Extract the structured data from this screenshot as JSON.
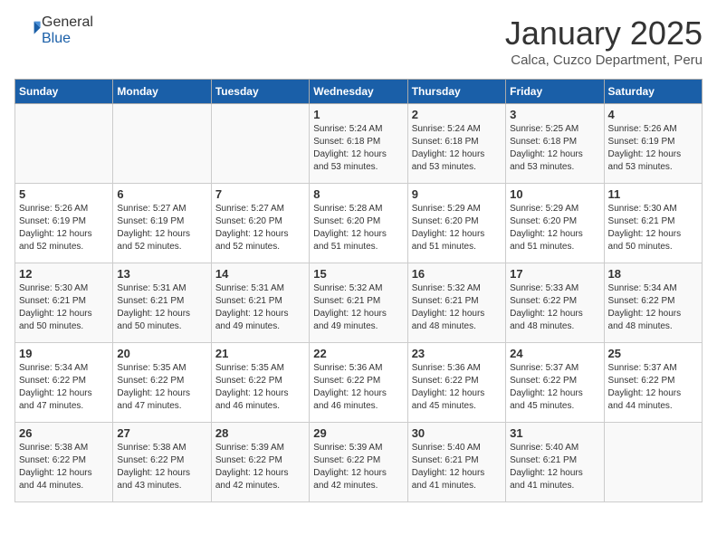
{
  "logo": {
    "general": "General",
    "blue": "Blue"
  },
  "header": {
    "month": "January 2025",
    "location": "Calca, Cuzco Department, Peru"
  },
  "days_of_week": [
    "Sunday",
    "Monday",
    "Tuesday",
    "Wednesday",
    "Thursday",
    "Friday",
    "Saturday"
  ],
  "weeks": [
    [
      {
        "day": "",
        "content": ""
      },
      {
        "day": "",
        "content": ""
      },
      {
        "day": "",
        "content": ""
      },
      {
        "day": "1",
        "content": "Sunrise: 5:24 AM\nSunset: 6:18 PM\nDaylight: 12 hours\nand 53 minutes."
      },
      {
        "day": "2",
        "content": "Sunrise: 5:24 AM\nSunset: 6:18 PM\nDaylight: 12 hours\nand 53 minutes."
      },
      {
        "day": "3",
        "content": "Sunrise: 5:25 AM\nSunset: 6:18 PM\nDaylight: 12 hours\nand 53 minutes."
      },
      {
        "day": "4",
        "content": "Sunrise: 5:26 AM\nSunset: 6:19 PM\nDaylight: 12 hours\nand 53 minutes."
      }
    ],
    [
      {
        "day": "5",
        "content": "Sunrise: 5:26 AM\nSunset: 6:19 PM\nDaylight: 12 hours\nand 52 minutes."
      },
      {
        "day": "6",
        "content": "Sunrise: 5:27 AM\nSunset: 6:19 PM\nDaylight: 12 hours\nand 52 minutes."
      },
      {
        "day": "7",
        "content": "Sunrise: 5:27 AM\nSunset: 6:20 PM\nDaylight: 12 hours\nand 52 minutes."
      },
      {
        "day": "8",
        "content": "Sunrise: 5:28 AM\nSunset: 6:20 PM\nDaylight: 12 hours\nand 51 minutes."
      },
      {
        "day": "9",
        "content": "Sunrise: 5:29 AM\nSunset: 6:20 PM\nDaylight: 12 hours\nand 51 minutes."
      },
      {
        "day": "10",
        "content": "Sunrise: 5:29 AM\nSunset: 6:20 PM\nDaylight: 12 hours\nand 51 minutes."
      },
      {
        "day": "11",
        "content": "Sunrise: 5:30 AM\nSunset: 6:21 PM\nDaylight: 12 hours\nand 50 minutes."
      }
    ],
    [
      {
        "day": "12",
        "content": "Sunrise: 5:30 AM\nSunset: 6:21 PM\nDaylight: 12 hours\nand 50 minutes."
      },
      {
        "day": "13",
        "content": "Sunrise: 5:31 AM\nSunset: 6:21 PM\nDaylight: 12 hours\nand 50 minutes."
      },
      {
        "day": "14",
        "content": "Sunrise: 5:31 AM\nSunset: 6:21 PM\nDaylight: 12 hours\nand 49 minutes."
      },
      {
        "day": "15",
        "content": "Sunrise: 5:32 AM\nSunset: 6:21 PM\nDaylight: 12 hours\nand 49 minutes."
      },
      {
        "day": "16",
        "content": "Sunrise: 5:32 AM\nSunset: 6:21 PM\nDaylight: 12 hours\nand 48 minutes."
      },
      {
        "day": "17",
        "content": "Sunrise: 5:33 AM\nSunset: 6:22 PM\nDaylight: 12 hours\nand 48 minutes."
      },
      {
        "day": "18",
        "content": "Sunrise: 5:34 AM\nSunset: 6:22 PM\nDaylight: 12 hours\nand 48 minutes."
      }
    ],
    [
      {
        "day": "19",
        "content": "Sunrise: 5:34 AM\nSunset: 6:22 PM\nDaylight: 12 hours\nand 47 minutes."
      },
      {
        "day": "20",
        "content": "Sunrise: 5:35 AM\nSunset: 6:22 PM\nDaylight: 12 hours\nand 47 minutes."
      },
      {
        "day": "21",
        "content": "Sunrise: 5:35 AM\nSunset: 6:22 PM\nDaylight: 12 hours\nand 46 minutes."
      },
      {
        "day": "22",
        "content": "Sunrise: 5:36 AM\nSunset: 6:22 PM\nDaylight: 12 hours\nand 46 minutes."
      },
      {
        "day": "23",
        "content": "Sunrise: 5:36 AM\nSunset: 6:22 PM\nDaylight: 12 hours\nand 45 minutes."
      },
      {
        "day": "24",
        "content": "Sunrise: 5:37 AM\nSunset: 6:22 PM\nDaylight: 12 hours\nand 45 minutes."
      },
      {
        "day": "25",
        "content": "Sunrise: 5:37 AM\nSunset: 6:22 PM\nDaylight: 12 hours\nand 44 minutes."
      }
    ],
    [
      {
        "day": "26",
        "content": "Sunrise: 5:38 AM\nSunset: 6:22 PM\nDaylight: 12 hours\nand 44 minutes."
      },
      {
        "day": "27",
        "content": "Sunrise: 5:38 AM\nSunset: 6:22 PM\nDaylight: 12 hours\nand 43 minutes."
      },
      {
        "day": "28",
        "content": "Sunrise: 5:39 AM\nSunset: 6:22 PM\nDaylight: 12 hours\nand 42 minutes."
      },
      {
        "day": "29",
        "content": "Sunrise: 5:39 AM\nSunset: 6:22 PM\nDaylight: 12 hours\nand 42 minutes."
      },
      {
        "day": "30",
        "content": "Sunrise: 5:40 AM\nSunset: 6:21 PM\nDaylight: 12 hours\nand 41 minutes."
      },
      {
        "day": "31",
        "content": "Sunrise: 5:40 AM\nSunset: 6:21 PM\nDaylight: 12 hours\nand 41 minutes."
      },
      {
        "day": "",
        "content": ""
      }
    ]
  ]
}
